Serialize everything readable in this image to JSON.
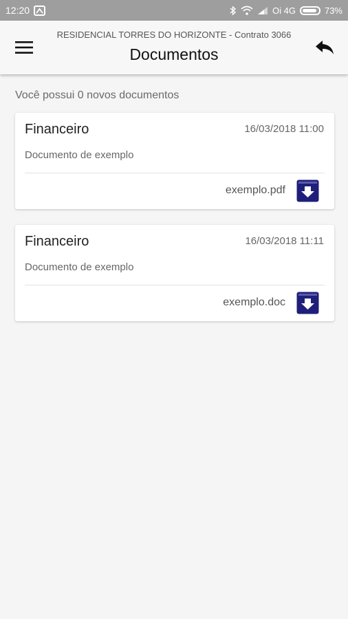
{
  "status_bar": {
    "time": "12:20",
    "carrier": "Oi 4G",
    "battery": "73%"
  },
  "header": {
    "subtitle": "RESIDENCIAL TORRES DO HORIZONTE - Contrato 3066",
    "title": "Documentos",
    "menu_icon": "hamburger-icon",
    "back_icon": "reply-arrow-icon"
  },
  "new_docs_text": "Você possui 0 novos documentos",
  "documents": [
    {
      "category": "Financeiro",
      "date": "16/03/2018 11:00",
      "description": "Documento de exemplo",
      "file": "exemplo.pdf",
      "icon": "download-box-icon"
    },
    {
      "category": "Financeiro",
      "date": "16/03/2018 11:11",
      "description": "Documento de exemplo",
      "file": "exemplo.doc",
      "icon": "download-box-icon"
    }
  ],
  "colors": {
    "status_bar": "#9e9e9e",
    "download_icon": "#1f1f7a",
    "background": "#f5f5f5"
  }
}
